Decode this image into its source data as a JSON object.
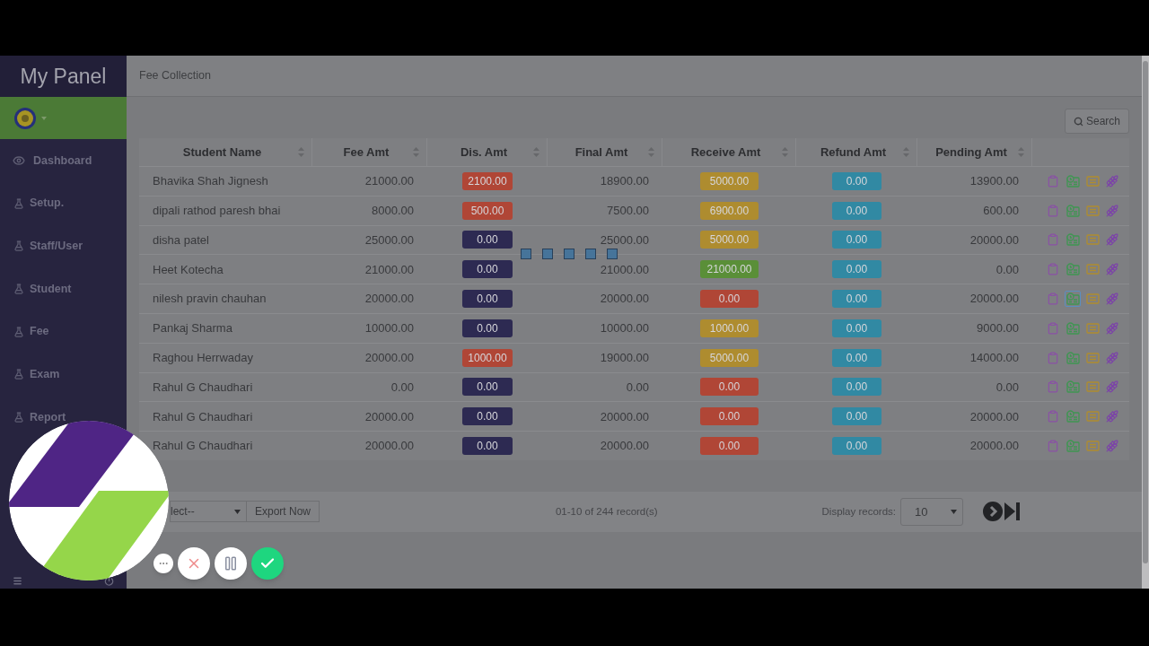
{
  "sidebar": {
    "brand": "My Panel",
    "items": [
      {
        "label": "Dashboard",
        "kind": "dashboard"
      },
      {
        "label": "Setup.",
        "kind": "module"
      },
      {
        "label": "Staff/User",
        "kind": "module"
      },
      {
        "label": "Student",
        "kind": "module"
      },
      {
        "label": "Fee",
        "kind": "module"
      },
      {
        "label": "Exam",
        "kind": "module"
      },
      {
        "label": "Report",
        "kind": "module"
      }
    ]
  },
  "page": {
    "title": "Fee Collection",
    "search_button": "Search"
  },
  "table": {
    "columns": [
      "Student Name",
      "Fee Amt",
      "Dis. Amt",
      "Final Amt",
      "Receive Amt",
      "Refund Amt",
      "Pending Amt"
    ],
    "rows": [
      {
        "student_name": "Bhavika Shah Jignesh",
        "fee_amt": "21000.00",
        "dis_amt": {
          "text": "2100.00",
          "color": "#b04636"
        },
        "final_amt": "18900.00",
        "receive_amt": {
          "text": "5000.00",
          "color": "#ae8c2f"
        },
        "refund_amt": {
          "text": "0.00",
          "color": "#3189a3"
        },
        "pending_amt": "13900.00",
        "actions": [
          {
            "focused": false
          },
          {
            "focused": false
          },
          {
            "focused": false
          },
          {
            "focused": false
          }
        ]
      },
      {
        "student_name": "dipali rathod paresh bhai",
        "fee_amt": "8000.00",
        "dis_amt": {
          "text": "500.00",
          "color": "#b04636"
        },
        "final_amt": "7500.00",
        "receive_amt": {
          "text": "6900.00",
          "color": "#ae8c2f"
        },
        "refund_amt": {
          "text": "0.00",
          "color": "#3189a3"
        },
        "pending_amt": "600.00",
        "actions": [
          {
            "focused": false
          },
          {
            "focused": false
          },
          {
            "focused": false
          },
          {
            "focused": false
          }
        ]
      },
      {
        "student_name": "disha patel",
        "fee_amt": "25000.00",
        "dis_amt": {
          "text": "0.00",
          "color": "#2d2a52"
        },
        "final_amt": "25000.00",
        "receive_amt": {
          "text": "5000.00",
          "color": "#ae8c2f"
        },
        "refund_amt": {
          "text": "0.00",
          "color": "#3189a3"
        },
        "pending_amt": "20000.00",
        "actions": [
          {
            "focused": false
          },
          {
            "focused": false
          },
          {
            "focused": false
          },
          {
            "focused": false
          }
        ]
      },
      {
        "student_name": "Heet Kotecha",
        "fee_amt": "21000.00",
        "dis_amt": {
          "text": "0.00",
          "color": "#2d2a52"
        },
        "final_amt": "21000.00",
        "receive_amt": {
          "text": "21000.00",
          "color": "#5a8f38"
        },
        "refund_amt": {
          "text": "0.00",
          "color": "#3189a3"
        },
        "pending_amt": "0.00",
        "actions": [
          {
            "focused": false
          },
          {
            "focused": false
          },
          {
            "focused": false
          },
          {
            "focused": false
          }
        ]
      },
      {
        "student_name": "nilesh pravin chauhan",
        "fee_amt": "20000.00",
        "dis_amt": {
          "text": "0.00",
          "color": "#2d2a52"
        },
        "final_amt": "20000.00",
        "receive_amt": {
          "text": "0.00",
          "color": "#b04636"
        },
        "refund_amt": {
          "text": "0.00",
          "color": "#3189a3"
        },
        "pending_amt": "20000.00",
        "actions": [
          {
            "focused": false
          },
          {
            "focused": true
          },
          {
            "focused": false
          },
          {
            "focused": false
          }
        ]
      },
      {
        "student_name": "Pankaj Sharma",
        "fee_amt": "10000.00",
        "dis_amt": {
          "text": "0.00",
          "color": "#2d2a52"
        },
        "final_amt": "10000.00",
        "receive_amt": {
          "text": "1000.00",
          "color": "#ae8c2f"
        },
        "refund_amt": {
          "text": "0.00",
          "color": "#3189a3"
        },
        "pending_amt": "9000.00",
        "actions": [
          {
            "focused": false
          },
          {
            "focused": false
          },
          {
            "focused": false
          },
          {
            "focused": false
          }
        ]
      },
      {
        "student_name": "Raghou Herrwaday",
        "fee_amt": "20000.00",
        "dis_amt": {
          "text": "1000.00",
          "color": "#b04636"
        },
        "final_amt": "19000.00",
        "receive_amt": {
          "text": "5000.00",
          "color": "#ae8c2f"
        },
        "refund_amt": {
          "text": "0.00",
          "color": "#3189a3"
        },
        "pending_amt": "14000.00",
        "actions": [
          {
            "focused": false
          },
          {
            "focused": false
          },
          {
            "focused": false
          },
          {
            "focused": false
          }
        ]
      },
      {
        "student_name": "Rahul G Chaudhari",
        "fee_amt": "0.00",
        "dis_amt": {
          "text": "0.00",
          "color": "#2d2a52"
        },
        "final_amt": "0.00",
        "receive_amt": {
          "text": "0.00",
          "color": "#b04636"
        },
        "refund_amt": {
          "text": "0.00",
          "color": "#3189a3"
        },
        "pending_amt": "0.00",
        "actions": [
          {
            "focused": false
          },
          {
            "focused": false
          },
          {
            "focused": false
          },
          {
            "focused": false
          }
        ]
      },
      {
        "student_name": "Rahul G Chaudhari",
        "fee_amt": "20000.00",
        "dis_amt": {
          "text": "0.00",
          "color": "#2d2a52"
        },
        "final_amt": "20000.00",
        "receive_amt": {
          "text": "0.00",
          "color": "#b04636"
        },
        "refund_amt": {
          "text": "0.00",
          "color": "#3189a3"
        },
        "pending_amt": "20000.00",
        "actions": [
          {
            "focused": false
          },
          {
            "focused": false
          },
          {
            "focused": false
          },
          {
            "focused": false
          }
        ]
      },
      {
        "student_name": "Rahul G Chaudhari",
        "fee_amt": "20000.00",
        "dis_amt": {
          "text": "0.00",
          "color": "#2d2a52"
        },
        "final_amt": "20000.00",
        "receive_amt": {
          "text": "0.00",
          "color": "#b04636"
        },
        "refund_amt": {
          "text": "0.00",
          "color": "#3189a3"
        },
        "pending_amt": "20000.00",
        "actions": [
          {
            "focused": false
          },
          {
            "focused": false
          },
          {
            "focused": false
          },
          {
            "focused": false
          }
        ]
      }
    ]
  },
  "loading": true,
  "footer": {
    "export_select": "lect--",
    "export_button": "Export Now",
    "record_info": "01-10 of 244 record(s)",
    "display_label": "Display records:",
    "display_value": "10"
  },
  "recorder_controls": [
    {
      "kind": "more"
    },
    {
      "kind": "cancel"
    },
    {
      "kind": "pause"
    },
    {
      "kind": "done"
    }
  ]
}
